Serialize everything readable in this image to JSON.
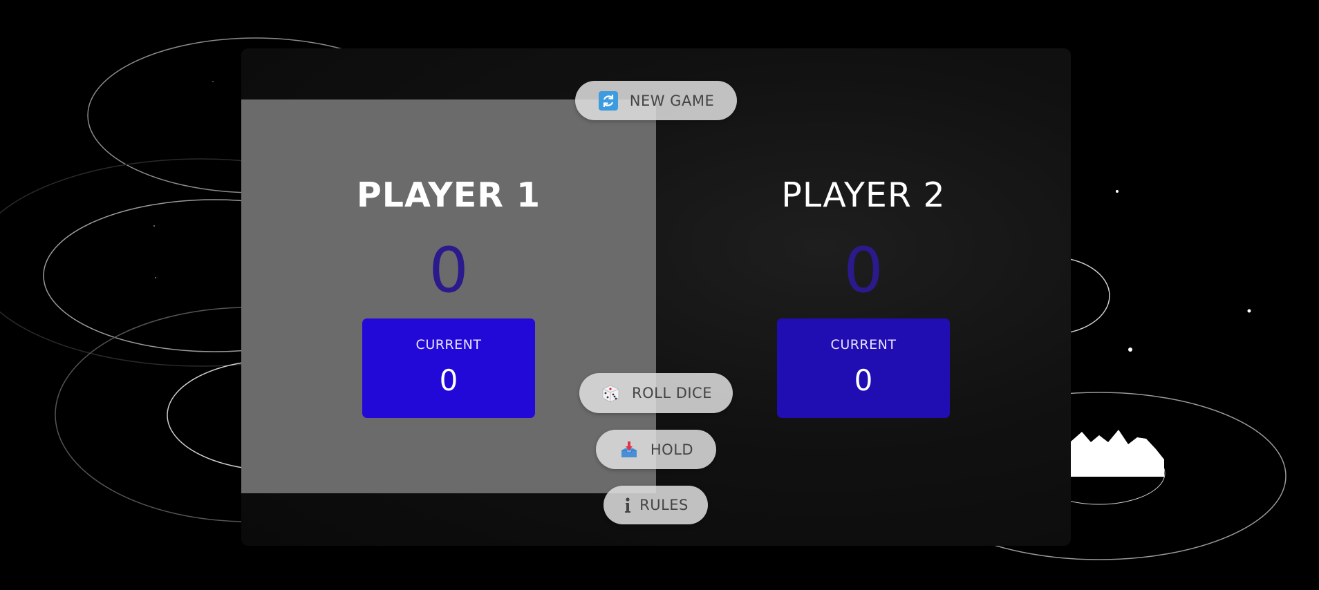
{
  "game": {
    "players": [
      {
        "name": "PLAYER 1",
        "score": "0",
        "current_label": "CURRENT",
        "current_score": "0",
        "active": true
      },
      {
        "name": "PLAYER 2",
        "score": "0",
        "current_label": "CURRENT",
        "current_score": "0",
        "active": false
      }
    ]
  },
  "controls": {
    "new_game": {
      "label": "NEW GAME",
      "icon": "refresh-icon"
    },
    "roll_dice": {
      "label": "ROLL DICE",
      "icon": "dice-icon"
    },
    "hold": {
      "label": "HOLD",
      "icon": "inbox-tray-icon"
    },
    "rules": {
      "label": "RULES",
      "icon": "info-icon"
    }
  },
  "colors": {
    "active_panel": "#6b6b6b",
    "score": "#2a1a8c",
    "current_box": "#2309d8",
    "button_bg": "#e1e1e1"
  }
}
